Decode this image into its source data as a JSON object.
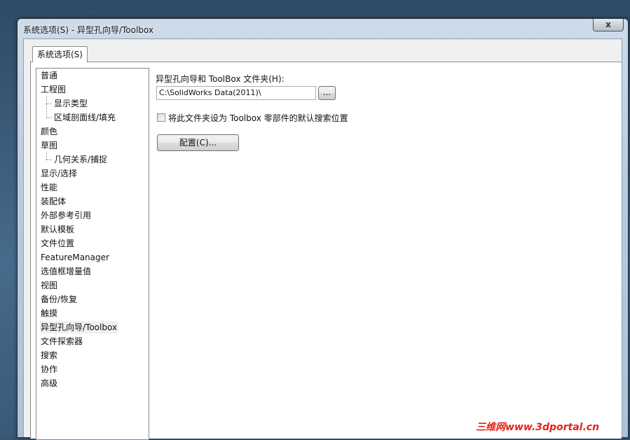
{
  "window": {
    "title": "系统选项(S) - 异型孔向导/Toolbox",
    "close_label": "x"
  },
  "tab": {
    "label": "系统选项(S)"
  },
  "tree": {
    "items": [
      {
        "label": "普通",
        "level": 0,
        "selected": false
      },
      {
        "label": "工程图",
        "level": 0,
        "selected": false
      },
      {
        "label": "显示类型",
        "level": 1,
        "selected": false
      },
      {
        "label": "区域剖面线/填充",
        "level": 1,
        "selected": false
      },
      {
        "label": "颜色",
        "level": 0,
        "selected": false
      },
      {
        "label": "草图",
        "level": 0,
        "selected": false
      },
      {
        "label": "几何关系/捕捉",
        "level": 1,
        "selected": false
      },
      {
        "label": "显示/选择",
        "level": 0,
        "selected": false
      },
      {
        "label": "性能",
        "level": 0,
        "selected": false
      },
      {
        "label": "装配体",
        "level": 0,
        "selected": false
      },
      {
        "label": "外部参考引用",
        "level": 0,
        "selected": false
      },
      {
        "label": "默认模板",
        "level": 0,
        "selected": false
      },
      {
        "label": "文件位置",
        "level": 0,
        "selected": false
      },
      {
        "label": "FeatureManager",
        "level": 0,
        "selected": false
      },
      {
        "label": "选值框增量值",
        "level": 0,
        "selected": false
      },
      {
        "label": "视图",
        "level": 0,
        "selected": false
      },
      {
        "label": "备份/恢复",
        "level": 0,
        "selected": false
      },
      {
        "label": "触摸",
        "level": 0,
        "selected": false
      },
      {
        "label": "异型孔向导/Toolbox",
        "level": 0,
        "selected": true
      },
      {
        "label": "文件探索器",
        "level": 0,
        "selected": false
      },
      {
        "label": "搜索",
        "level": 0,
        "selected": false
      },
      {
        "label": "协作",
        "level": 0,
        "selected": false
      },
      {
        "label": "高级",
        "level": 0,
        "selected": false
      }
    ]
  },
  "content": {
    "folder_label": "异型孔向导和 ToolBox 文件夹(H):",
    "folder_path": "C:\\SolidWorks Data(2011)\\",
    "browse_label": "...",
    "default_search_label": "将此文件夹设为 Toolbox 零部件的默认搜索位置",
    "default_search_checked": false,
    "configure_label": "配置(C)..."
  },
  "watermark": {
    "text": "三维网www.3dportal.cn"
  }
}
